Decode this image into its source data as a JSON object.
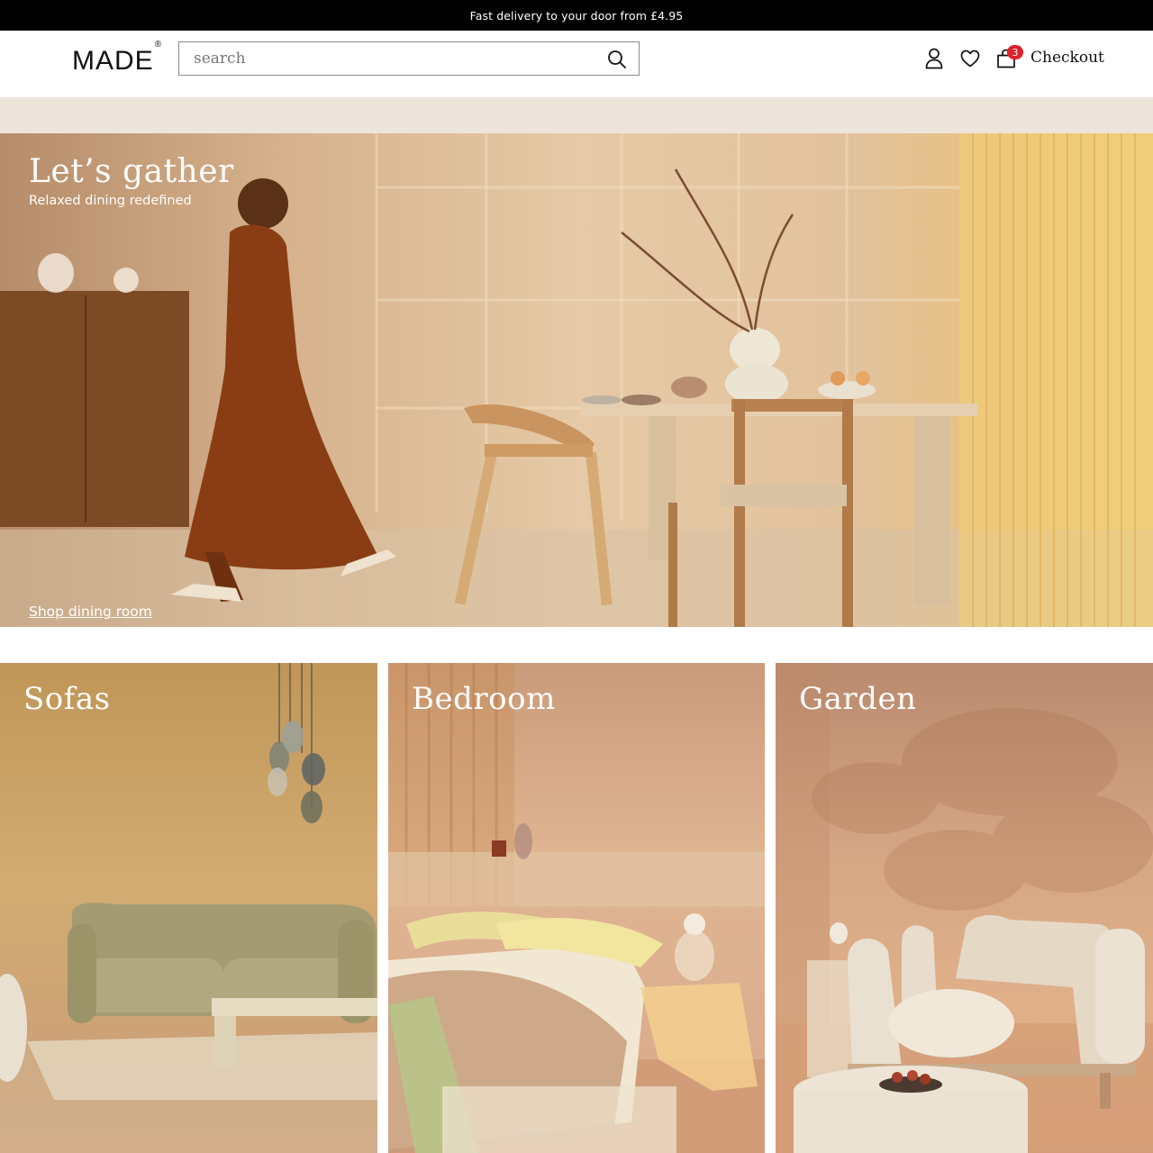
{
  "promo": {
    "text": "Fast delivery to your door from £4.95"
  },
  "header": {
    "logo": "MADE",
    "logo_mark": "®",
    "search_placeholder": "search",
    "basket_count": "3",
    "checkout_label": "Checkout",
    "icons": [
      "search-icon",
      "account-icon",
      "heart-icon",
      "basket-icon"
    ]
  },
  "hero": {
    "title": "Let’s gather",
    "subtitle": "Relaxed dining redefined",
    "link": "Shop dining room"
  },
  "tiles": [
    {
      "title": "Sofas"
    },
    {
      "title": "Bedroom"
    },
    {
      "title": "Garden"
    }
  ],
  "colors": {
    "promo_bg": "#000000",
    "strip_bg": "#ede4dc",
    "badge": "#e0202a"
  }
}
